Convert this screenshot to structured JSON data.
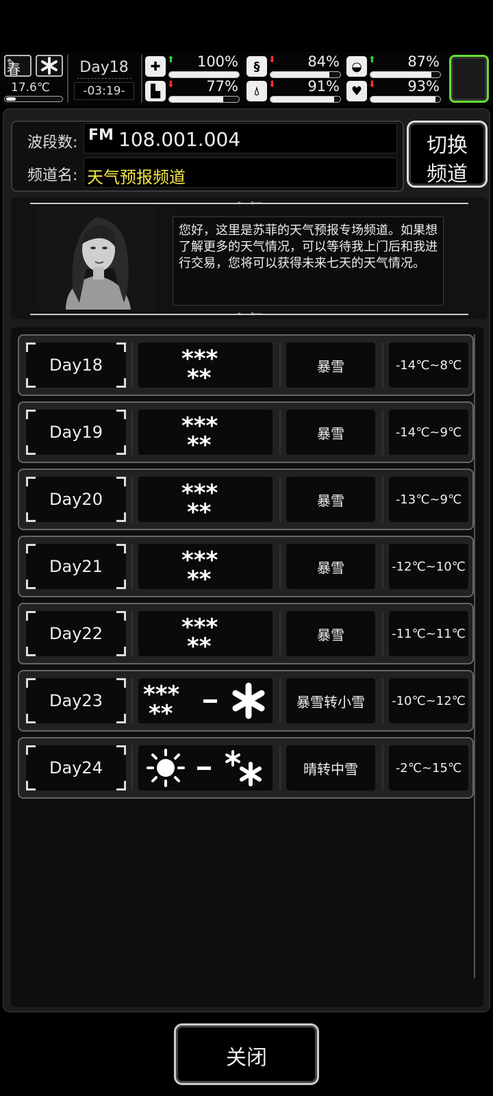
{
  "status": {
    "season": "春",
    "temperature": "17.6℃",
    "day": "Day18",
    "time": "-03:19-",
    "stats": [
      {
        "name": "health",
        "icon": "medkit-icon",
        "trend": "up",
        "value": "100%",
        "level": 1.0
      },
      {
        "name": "hunger",
        "icon": "stomach-icon",
        "trend": "down",
        "value": "84%",
        "level": 0.84
      },
      {
        "name": "medicine",
        "icon": "pill-icon",
        "trend": "up",
        "value": "87%",
        "level": 0.87
      },
      {
        "name": "stamina",
        "icon": "boot-icon",
        "trend": "down",
        "value": "77%",
        "level": 0.77
      },
      {
        "name": "thirst",
        "icon": "water-drop-icon",
        "trend": "down",
        "value": "91%",
        "level": 0.91
      },
      {
        "name": "mood",
        "icon": "heart-icon",
        "trend": "down",
        "value": "93%",
        "level": 0.93
      }
    ]
  },
  "radio": {
    "band_label": "波段数:",
    "fm_icon": "FM",
    "frequency": "108.001.004",
    "channel_label": "频道名:",
    "channel_name": "天气预报频道",
    "switch_line1": "切换",
    "switch_line2": "频道"
  },
  "intro": {
    "message": "您好，这里是苏菲的天气预报专场频道。如果想了解更多的天气情况，可以等待我上门后和我进行交易，您将可以获得未来七天的天气情况。"
  },
  "forecast": [
    {
      "day": "Day18",
      "icons": [
        "blizzard-icon"
      ],
      "desc": "暴雪",
      "temp": "-14℃~8℃"
    },
    {
      "day": "Day19",
      "icons": [
        "blizzard-icon"
      ],
      "desc": "暴雪",
      "temp": "-14℃~9℃"
    },
    {
      "day": "Day20",
      "icons": [
        "blizzard-icon"
      ],
      "desc": "暴雪",
      "temp": "-13℃~9℃"
    },
    {
      "day": "Day21",
      "icons": [
        "blizzard-icon"
      ],
      "desc": "暴雪",
      "temp": "-12℃~10℃"
    },
    {
      "day": "Day22",
      "icons": [
        "blizzard-icon"
      ],
      "desc": "暴雪",
      "temp": "-11℃~11℃"
    },
    {
      "day": "Day23",
      "icons": [
        "blizzard-icon",
        "light-snow-icon"
      ],
      "desc": "暴雪转小雪",
      "temp": "-10℃~12℃"
    },
    {
      "day": "Day24",
      "icons": [
        "sun-icon",
        "moderate-snow-icon"
      ],
      "desc": "晴转中雪",
      "temp": "-2℃~15℃"
    }
  ],
  "close_label": "关闭",
  "colors": {
    "channel_yellow": "#f5e642",
    "up_green": "#2ecc40",
    "down_red": "#ff3030",
    "frame_green": "#66dd33"
  }
}
